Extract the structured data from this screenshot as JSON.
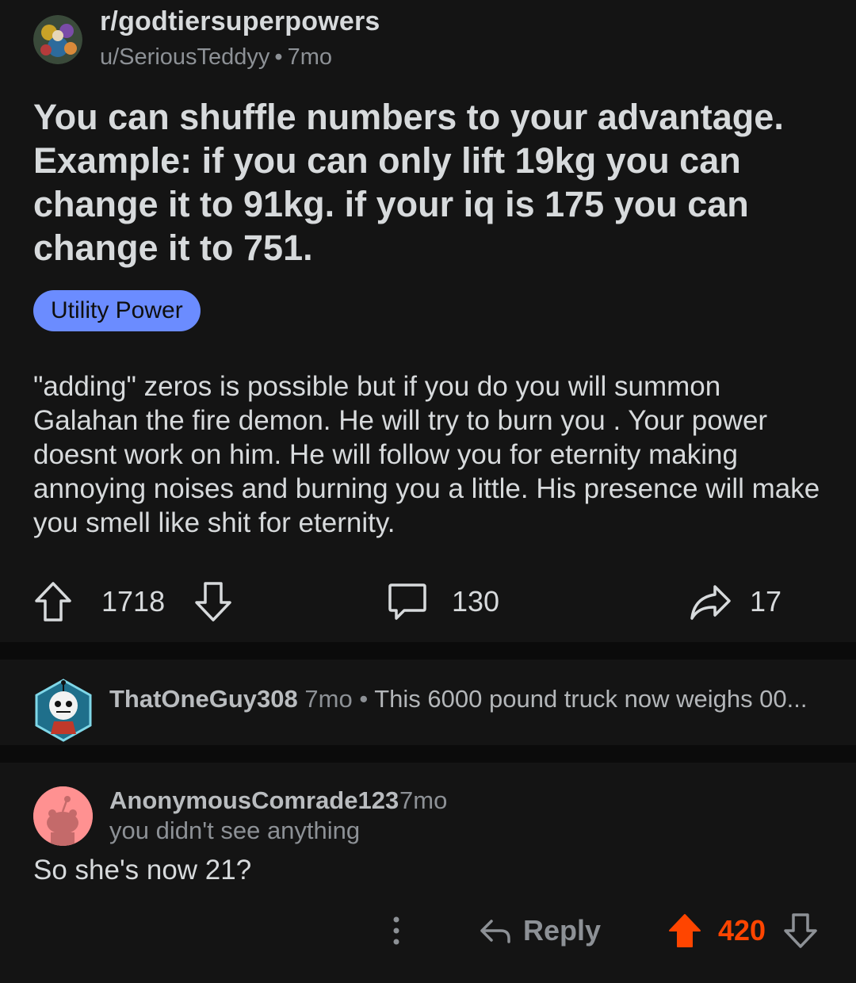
{
  "post": {
    "subreddit": "r/godtiersuperpowers",
    "author": "u/SeriousTeddyy",
    "age": "7mo",
    "title": "You can shuffle numbers to your advantage. Example: if you can only lift 19kg you can change it to 91kg. if your iq is 175 you can change it to 751.",
    "flair": "Utility Power",
    "flair_color": "#6b8cff",
    "body": "\"adding\" zeros is possible but if you do you will summon Galahan the fire demon. He will try to burn you . Your power doesnt work on him. He will follow you for eternity making annoying noises and burning you a little. His presence will make you smell like shit for eternity.",
    "upvotes": "1718",
    "comments": "130",
    "shares": "17"
  },
  "collapsed_comment": {
    "username": "ThatOneGuy308",
    "age": "7mo",
    "separator": "•",
    "snippet": "This 6000 pound truck now weighs 00..."
  },
  "comment": {
    "username": "AnonymousComrade123",
    "age": "7mo",
    "user_flair": "you didn't see anything",
    "text": "So she's now 21?",
    "reply_label": "Reply",
    "score": "420",
    "score_color": "#ff4500"
  },
  "icons": {
    "upvote": "arrow-up-outline-icon",
    "downvote": "arrow-down-outline-icon",
    "comment": "speech-bubble-icon",
    "share": "share-arrow-icon",
    "more": "vertical-ellipsis-icon",
    "reply": "reply-arrow-icon",
    "upvote_active": "arrow-up-filled-icon"
  }
}
